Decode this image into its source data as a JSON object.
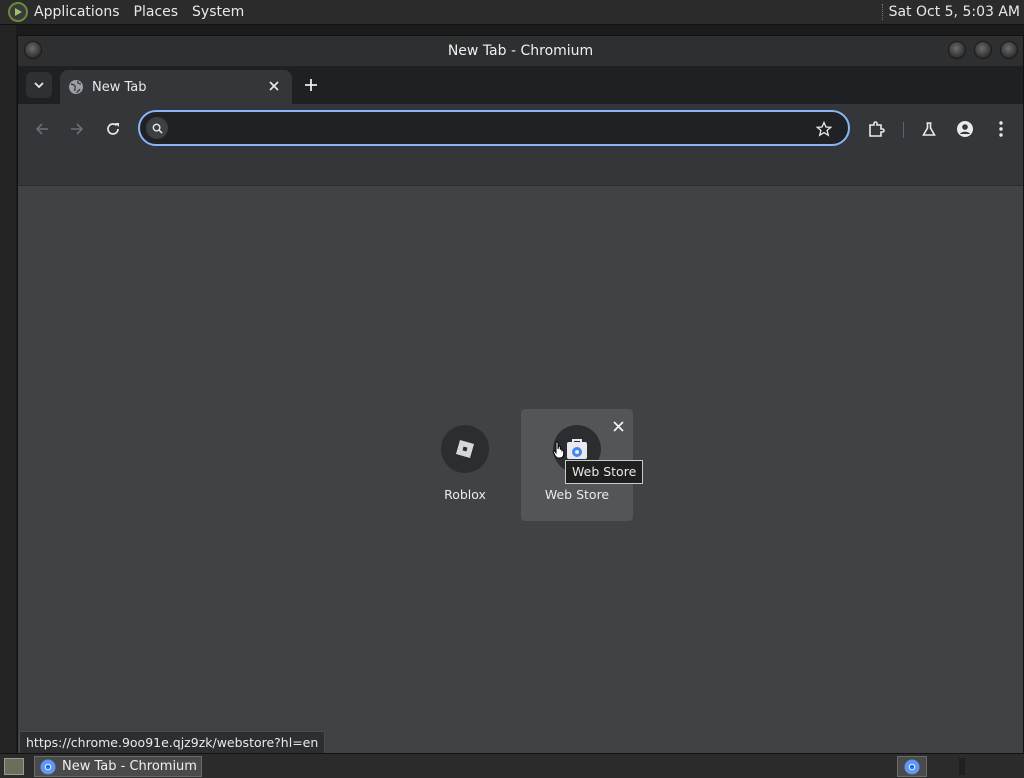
{
  "top_panel": {
    "menus": [
      "Applications",
      "Places",
      "System"
    ],
    "clock": "Sat Oct  5,  5:03 AM"
  },
  "window": {
    "title": "New Tab - Chromium"
  },
  "tabs": [
    {
      "label": "New Tab",
      "active": true
    }
  ],
  "omnibox": {
    "value": "",
    "placeholder": ""
  },
  "shortcuts": [
    {
      "label": "Roblox",
      "icon": "roblox-icon"
    },
    {
      "label": "Web Store",
      "icon": "webstore-icon"
    }
  ],
  "tooltip": "Web Store",
  "status_url": "https://chrome.9oo91e.qjz9zk/webstore?hl=en",
  "taskbar": {
    "task_label": "New Tab - Chromium"
  },
  "colors": {
    "omnibox_focus": "#8ab4f8",
    "content_bg": "#414246",
    "toolbar_bg": "#35363a"
  }
}
